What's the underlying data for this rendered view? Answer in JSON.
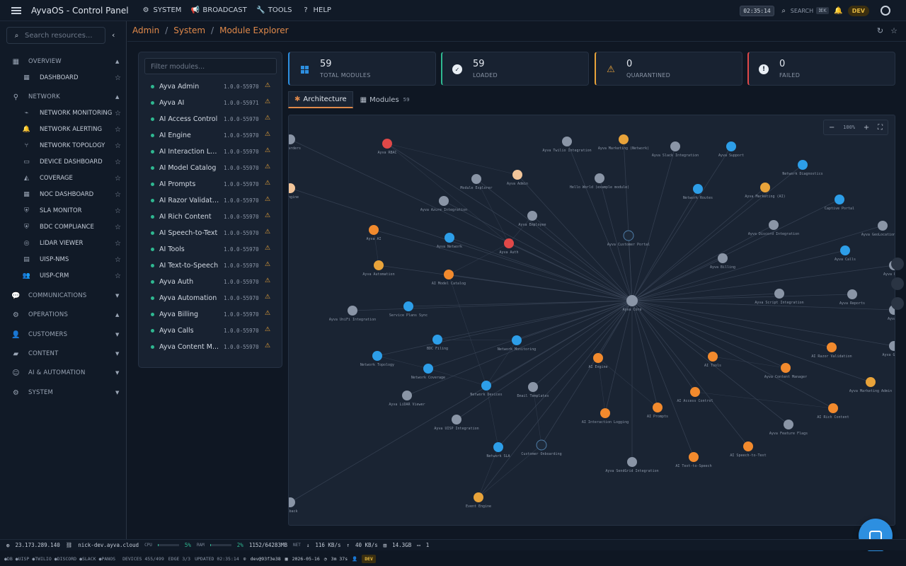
{
  "app": {
    "title": "AyvaOS - Control Panel"
  },
  "topmenu": [
    {
      "label": "SYSTEM",
      "icon": "gear-icon"
    },
    {
      "label": "BROADCAST",
      "icon": "megaphone-icon"
    },
    {
      "label": "TOOLS",
      "icon": "wrench-icon"
    },
    {
      "label": "HELP",
      "icon": "help-icon"
    }
  ],
  "topright": {
    "clock": "02:35:14",
    "search_label": "SEARCH",
    "search_kbd": "⌘K",
    "env": "DEV"
  },
  "sidebar": {
    "search_placeholder": "Search resources...",
    "sections": [
      {
        "label": "OVERVIEW",
        "items": [
          {
            "label": "DASHBOARD"
          }
        ]
      },
      {
        "label": "NETWORK",
        "items": [
          {
            "label": "NETWORK MONITORING"
          },
          {
            "label": "NETWORK ALERTING"
          },
          {
            "label": "NETWORK TOPOLOGY"
          },
          {
            "label": "DEVICE DASHBOARD"
          },
          {
            "label": "COVERAGE"
          },
          {
            "label": "NOC DASHBOARD"
          },
          {
            "label": "SLA MONITOR"
          },
          {
            "label": "BDC COMPLIANCE"
          },
          {
            "label": "LIDAR VIEWER"
          },
          {
            "label": "UISP-NMS"
          },
          {
            "label": "UISP-CRM"
          }
        ]
      },
      {
        "label": "COMMUNICATIONS"
      },
      {
        "label": "OPERATIONS"
      },
      {
        "label": "CUSTOMERS"
      },
      {
        "label": "CONTENT"
      },
      {
        "label": "AI & AUTOMATION"
      },
      {
        "label": "SYSTEM"
      }
    ]
  },
  "breadcrumb": [
    "Admin",
    "System",
    "Module Explorer"
  ],
  "filter_placeholder": "Filter modules...",
  "modules": [
    {
      "name": "Ayva Admin",
      "version": "1.0.0-55970"
    },
    {
      "name": "Ayva AI",
      "version": "1.0.0-55971"
    },
    {
      "name": "AI Access Control",
      "version": "1.0.0-55970"
    },
    {
      "name": "AI Engine",
      "version": "1.0.0-55970"
    },
    {
      "name": "AI Interaction Lo...",
      "version": "1.0.0-55970"
    },
    {
      "name": "AI Model Catalog",
      "version": "1.0.0-55970"
    },
    {
      "name": "AI Prompts",
      "version": "1.0.0-55970"
    },
    {
      "name": "AI Razor Validati...",
      "version": "1.0.0-55970"
    },
    {
      "name": "AI Rich Content",
      "version": "1.0.0-55970"
    },
    {
      "name": "AI Speech-to-Text",
      "version": "1.0.0-55970"
    },
    {
      "name": "AI Tools",
      "version": "1.0.0-55970"
    },
    {
      "name": "AI Text-to-Speech",
      "version": "1.0.0-55970"
    },
    {
      "name": "Ayva Auth",
      "version": "1.0.0-55970"
    },
    {
      "name": "Ayva Automation",
      "version": "1.0.0-55970"
    },
    {
      "name": "Ayva Billing",
      "version": "1.0.0-55970"
    },
    {
      "name": "Ayva Calls",
      "version": "1.0.0-55970"
    },
    {
      "name": "Ayva Content M...",
      "version": "1.0.0-55970"
    }
  ],
  "stats": [
    {
      "value": "59",
      "label": "TOTAL MODULES",
      "color": "#2d8fe0"
    },
    {
      "value": "59",
      "label": "LOADED",
      "color": "#2fb891"
    },
    {
      "value": "0",
      "label": "QUARANTINED",
      "color": "#e8a33a"
    },
    {
      "value": "0",
      "label": "FAILED",
      "color": "#e04848"
    }
  ],
  "tabs": [
    {
      "label": "Architecture"
    },
    {
      "label": "Modules",
      "count": "59"
    }
  ],
  "zoom": "100%",
  "graph": {
    "center": "Ayva Core",
    "nodes": [
      {
        "label": "Forwarders",
        "color": "#8a95a6"
      },
      {
        "label": "Ayva RBAC",
        "color": "#e04848"
      },
      {
        "label": "Ayva Twilio Integration",
        "color": "#8a95a6"
      },
      {
        "label": "Ayva Marketing (Network)",
        "color": "#e8a33a"
      },
      {
        "label": "Ayva Slack Integration",
        "color": "#8a95a6"
      },
      {
        "label": "Ayva Support",
        "color": "#2d9ee8"
      },
      {
        "label": "Network Diagnostics",
        "color": "#2d9ee8"
      },
      {
        "label": "h Engine",
        "color": "#f2c59a"
      },
      {
        "label": "Module Explorer",
        "color": "#8a95a6"
      },
      {
        "label": "Ayva Admin",
        "color": "#f2c59a"
      },
      {
        "label": "Hello World (example module)",
        "color": "#8a95a6"
      },
      {
        "label": "Network Routes",
        "color": "#2d9ee8"
      },
      {
        "label": "Ayva Marketing (AI)",
        "color": "#e8a33a"
      },
      {
        "label": "Captive Portal",
        "color": "#2d9ee8"
      },
      {
        "label": "Ayva Azure Integration",
        "color": "#8a95a6"
      },
      {
        "label": "Ayva Employee",
        "color": "#8a95a6"
      },
      {
        "label": "Ayva Discord Integration",
        "color": "#8a95a6"
      },
      {
        "label": "Ayva GeoLocation Int",
        "color": "#8a95a6"
      },
      {
        "label": "Ayva AI",
        "color": "#f28a2d"
      },
      {
        "label": "Ayva Network",
        "color": "#2d9ee8"
      },
      {
        "label": "Ayva Auth",
        "color": "#e04848"
      },
      {
        "label": "Ayva Customer Portal",
        "color": "#1e2a3a"
      },
      {
        "label": "Ayva Billing",
        "color": "#8a95a6"
      },
      {
        "label": "Ayva Calls",
        "color": "#2d9ee8"
      },
      {
        "label": "Ayva Automation",
        "color": "#e8a33a"
      },
      {
        "label": "AI Model Catalog",
        "color": "#f28a2d"
      },
      {
        "label": "Ayva Payme",
        "color": "#8a95a6"
      },
      {
        "label": "Ayva Script Integration",
        "color": "#8a95a6"
      },
      {
        "label": "Ayva Reports",
        "color": "#8a95a6"
      },
      {
        "label": "Ayva T",
        "color": "#8a95a6"
      },
      {
        "label": "Ayva UniFi Integration",
        "color": "#8a95a6"
      },
      {
        "label": "Service Plans Sync",
        "color": "#2d9ee8"
      },
      {
        "label": "BDC Filing",
        "color": "#2d9ee8"
      },
      {
        "label": "Network Monitoring",
        "color": "#2d9ee8"
      },
      {
        "label": "AI Razor Validation",
        "color": "#f28a2d"
      },
      {
        "label": "Ayva GitHub",
        "color": "#8a95a6"
      },
      {
        "label": "Network Topology",
        "color": "#2d9ee8"
      },
      {
        "label": "AI Engine",
        "color": "#f28a2d"
      },
      {
        "label": "AI Tools",
        "color": "#f28a2d"
      },
      {
        "label": "Ayva Content Manager",
        "color": "#f28a2d"
      },
      {
        "label": "Network Coverage",
        "color": "#2d9ee8"
      },
      {
        "label": "Ayva Marketing Admin",
        "color": "#e8a33a"
      },
      {
        "label": "Ayva LiDAR Viewer",
        "color": "#8a95a6"
      },
      {
        "label": "Network Devices",
        "color": "#2d9ee8"
      },
      {
        "label": "Email Templates",
        "color": "#8a95a6"
      },
      {
        "label": "AI Access Control",
        "color": "#f28a2d"
      },
      {
        "label": "AI Rich Content",
        "color": "#f28a2d"
      },
      {
        "label": "AI Interaction Logging",
        "color": "#f28a2d"
      },
      {
        "label": "AI Prompts",
        "color": "#f28a2d"
      },
      {
        "label": "Ayva UISP Integration",
        "color": "#8a95a6"
      },
      {
        "label": "Ayva Feature Flags",
        "color": "#8a95a6"
      },
      {
        "label": "Network SLA",
        "color": "#2d9ee8"
      },
      {
        "label": "Customer Onboarding",
        "color": "#1e2a3a"
      },
      {
        "label": "Ayva SendGrid Integration",
        "color": "#8a95a6"
      },
      {
        "label": "AI Text-to-Speech",
        "color": "#f28a2d"
      },
      {
        "label": "AI Speech-to-Text",
        "color": "#f28a2d"
      },
      {
        "label": "Event Engine",
        "color": "#e8a33a"
      },
      {
        "label": "tchback",
        "color": "#8a95a6"
      }
    ]
  },
  "status1": {
    "ip": "23.173.289.140",
    "host": "nick-dev.ayva.cloud",
    "cpu_label": "CPU",
    "cpu": "5%",
    "cpu_level": 0.05,
    "ram_label": "RAM",
    "ram": "2%",
    "ram_level": 0.02,
    "mem": "1152/64283MB",
    "net_label": "NET",
    "down": "116 KB/s",
    "up": "40 KB/s",
    "disk": "14.3GB",
    "screens": "1"
  },
  "status2": {
    "services": [
      "DB",
      "UISP",
      "TWILIO",
      "DISCORD",
      "SLACK",
      "PANOS"
    ],
    "devices": "DEVICES 455/499",
    "edge": "EDGE 3/3",
    "updated": "UPDATED 02:35:14",
    "commit": "dev@93f3e38",
    "date": "2026-05-16",
    "uptime": "3m 37s",
    "env": "DEV"
  }
}
